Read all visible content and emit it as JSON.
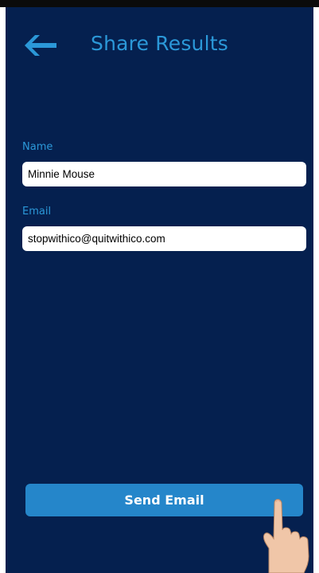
{
  "header": {
    "back_icon": "arrow-left-icon",
    "title": "Share Results"
  },
  "form": {
    "name_label": "Name",
    "name_value": "Minnie Mouse",
    "email_label": "Email",
    "email_value": "stopwithico@quitwithico.com"
  },
  "actions": {
    "send_label": "Send Email"
  },
  "overlay": {
    "hand_icon": "pointing-hand-icon"
  },
  "colors": {
    "background": "#05204f",
    "accent": "#2b98d8",
    "button": "#2586ca",
    "input_bg": "#ffffff",
    "button_text": "#ffffff"
  }
}
